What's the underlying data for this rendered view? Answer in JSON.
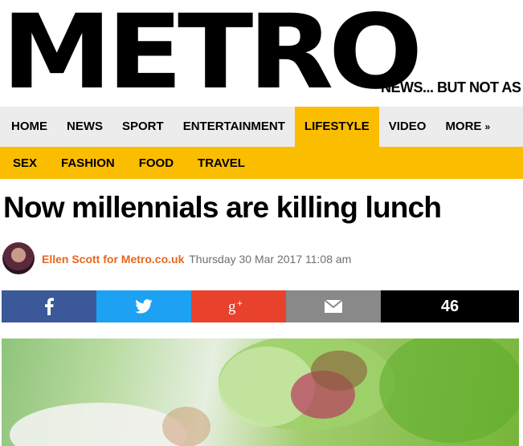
{
  "brand": {
    "logo": "METRO",
    "tagline": "NEWS... BUT NOT AS"
  },
  "nav": {
    "items": [
      "HOME",
      "NEWS",
      "SPORT",
      "ENTERTAINMENT",
      "LIFESTYLE",
      "VIDEO",
      "MORE"
    ],
    "active": "LIFESTYLE",
    "more_icon": "double-chevron-down-icon"
  },
  "subnav": {
    "items": [
      "SEX",
      "FASHION",
      "FOOD",
      "TRAVEL"
    ]
  },
  "article": {
    "headline": "Now millennials are killing lunch",
    "author": "Ellen Scott for Metro.co.uk",
    "date": "Thursday 30 Mar 2017 11:08 am"
  },
  "share": {
    "buttons": [
      {
        "name": "facebook",
        "icon": "facebook-icon",
        "color": "#3b5998"
      },
      {
        "name": "twitter",
        "icon": "twitter-icon",
        "color": "#1da1f2"
      },
      {
        "name": "google-plus",
        "icon": "google-plus-icon",
        "color": "#e8412c"
      },
      {
        "name": "email",
        "icon": "email-icon",
        "color": "#898989"
      }
    ],
    "count": "46"
  },
  "colors": {
    "accent": "#fbbd00",
    "author": "#e8661d",
    "nav_bg": "#ececec"
  }
}
